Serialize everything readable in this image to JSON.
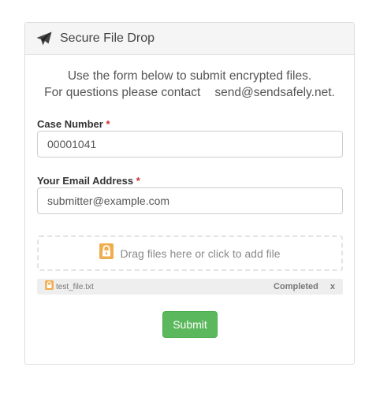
{
  "header": {
    "icon": "paper-plane-icon",
    "title": "Secure File Drop"
  },
  "intro": {
    "line1": "Use the form below to submit encrypted files.",
    "line2_prefix": "For questions please contact",
    "line2_email": "send@sendsafely.net."
  },
  "case_number": {
    "label": "Case Number",
    "required_mark": "*",
    "value": "00001041"
  },
  "email": {
    "label": "Your Email Address",
    "required_mark": "*",
    "value": "submitter@example.com"
  },
  "dropzone": {
    "icon": "lock-icon",
    "text": "Drag files here or click to add file"
  },
  "files": [
    {
      "icon": "lock-icon",
      "name": "test_file.txt",
      "status": "Completed",
      "remove": "x"
    }
  ],
  "submit": {
    "label": "Submit"
  },
  "colors": {
    "accent_orange": "#f0ad4e",
    "submit_green": "#5cb85c",
    "required_red": "#c9302c"
  }
}
